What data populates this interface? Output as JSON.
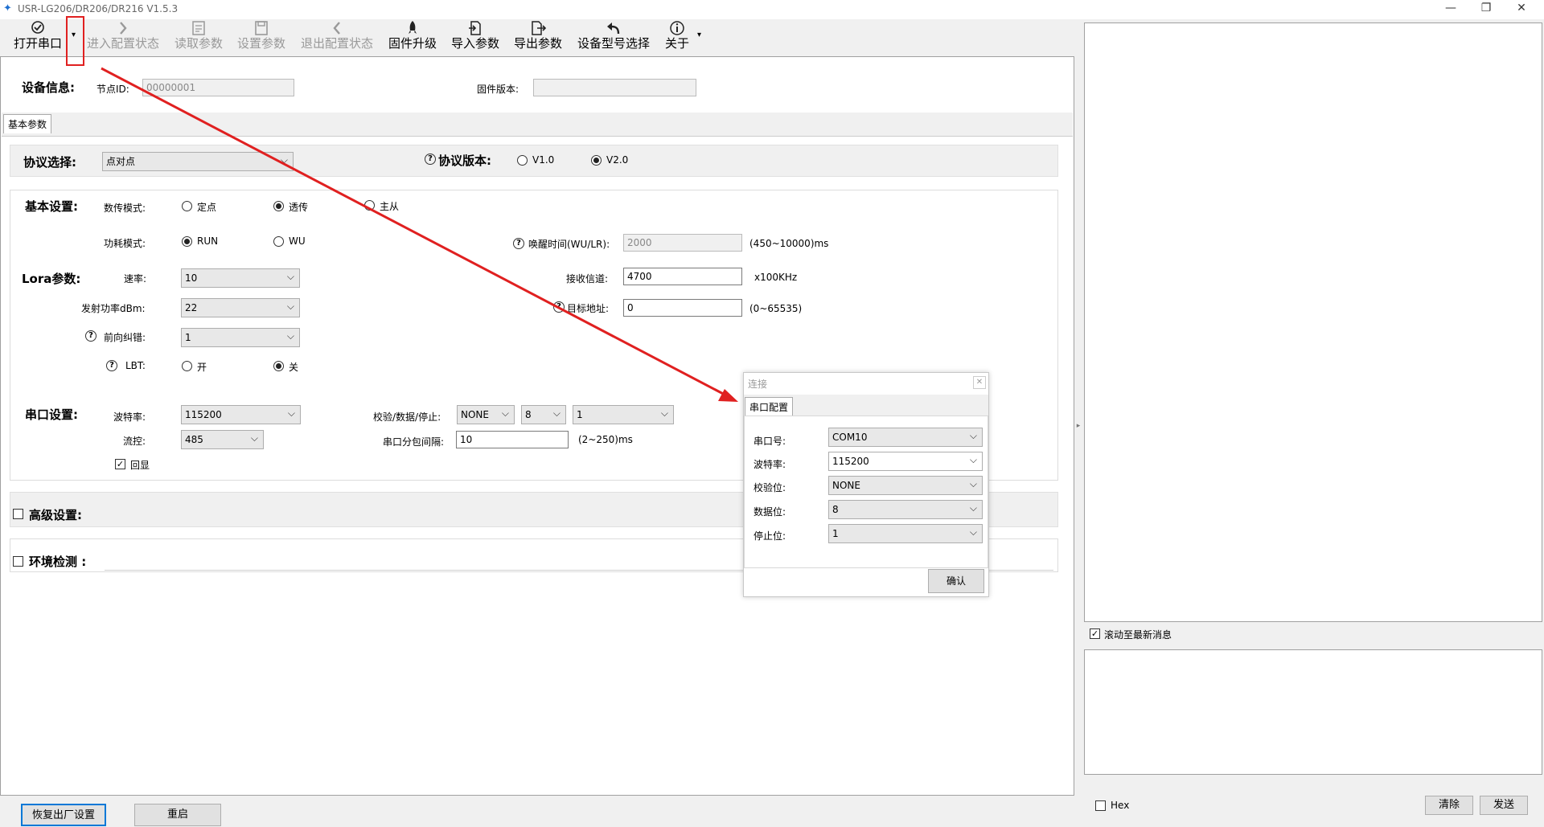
{
  "window": {
    "title": "USR-LG206/DR206/DR216 V1.5.3",
    "minimize": "—",
    "restore": "❐",
    "close": "✕"
  },
  "toolbar": {
    "open_port": "打开串口",
    "enter_config": "进入配置状态",
    "read_params": "读取参数",
    "set_params": "设置参数",
    "exit_config": "退出配置状态",
    "firmware_upgrade": "固件升级",
    "import_params": "导入参数",
    "export_params": "导出参数",
    "device_model": "设备型号选择",
    "about": "关于"
  },
  "device_info": {
    "heading": "设备信息:",
    "node_id_label": "节点ID:",
    "node_id_value": "00000001",
    "firmware_label": "固件版本:",
    "firmware_value": ""
  },
  "tabs": {
    "basic": "基本参数"
  },
  "protocol": {
    "heading": "协议选择:",
    "value": "点对点",
    "version_heading": "协议版本:",
    "v1": "V1.0",
    "v2": "V2.0"
  },
  "basic": {
    "heading": "基本设置:",
    "transfer_label": "数传模式:",
    "transfer_opts": [
      "定点",
      "透传",
      "主从"
    ],
    "power_label": "功耗模式:",
    "power_opts": [
      "RUN",
      "WU"
    ],
    "wake_label": "唤醒时间(WU/LR):",
    "wake_value": "2000",
    "wake_hint": "(450~10000)ms"
  },
  "lora": {
    "heading": "Lora参数:",
    "rate_label": "速率:",
    "rate_value": "10",
    "tx_power_label": "发射功率dBm:",
    "tx_power_value": "22",
    "fec_label": "前向纠错:",
    "fec_value": "1",
    "lbt_label": "LBT:",
    "lbt_on": "开",
    "lbt_off": "关",
    "channel_label": "接收信道:",
    "channel_value": "4700",
    "channel_unit": "x100KHz",
    "target_label": "目标地址:",
    "target_value": "0",
    "target_hint": "(0~65535)"
  },
  "serial": {
    "heading": "串口设置:",
    "baud_label": "波特率:",
    "baud_value": "115200",
    "flow_label": "流控:",
    "flow_value": "485",
    "echo_label": "回显",
    "parity_label": "校验/数据/停止:",
    "parity_value": "NONE",
    "data_value": "8",
    "stop_value": "1",
    "packet_label": "串口分包间隔:",
    "packet_value": "10",
    "packet_hint": "(2~250)ms"
  },
  "advanced": {
    "heading": "高级设置:"
  },
  "env": {
    "heading": "环境检测 :"
  },
  "bottom": {
    "factory_reset": "恢复出厂设置",
    "restart": "重启"
  },
  "right": {
    "scroll_latest": "滚动至最新消息",
    "hex": "Hex",
    "clear": "清除",
    "send": "发送"
  },
  "dialog": {
    "title": "连接",
    "close": "✕",
    "tab": "串口配置",
    "port_label": "串口号:",
    "port_value": "COM10",
    "baud_label": "波特率:",
    "baud_value": "115200",
    "parity_label": "校验位:",
    "parity_value": "NONE",
    "data_label": "数据位:",
    "data_value": "8",
    "stop_label": "停止位:",
    "stop_value": "1",
    "confirm": "确认"
  },
  "colors": {
    "annotation": "#e02020",
    "selected_tab_border": "#0078d7"
  },
  "icons": [
    "checkmark-icon",
    "chevron-right-icon",
    "read-icon",
    "save-icon",
    "chevron-left-icon",
    "rocket-icon",
    "import-icon",
    "export-icon",
    "back-arrow-icon",
    "info-icon",
    "dropdown-arrow-icon"
  ]
}
